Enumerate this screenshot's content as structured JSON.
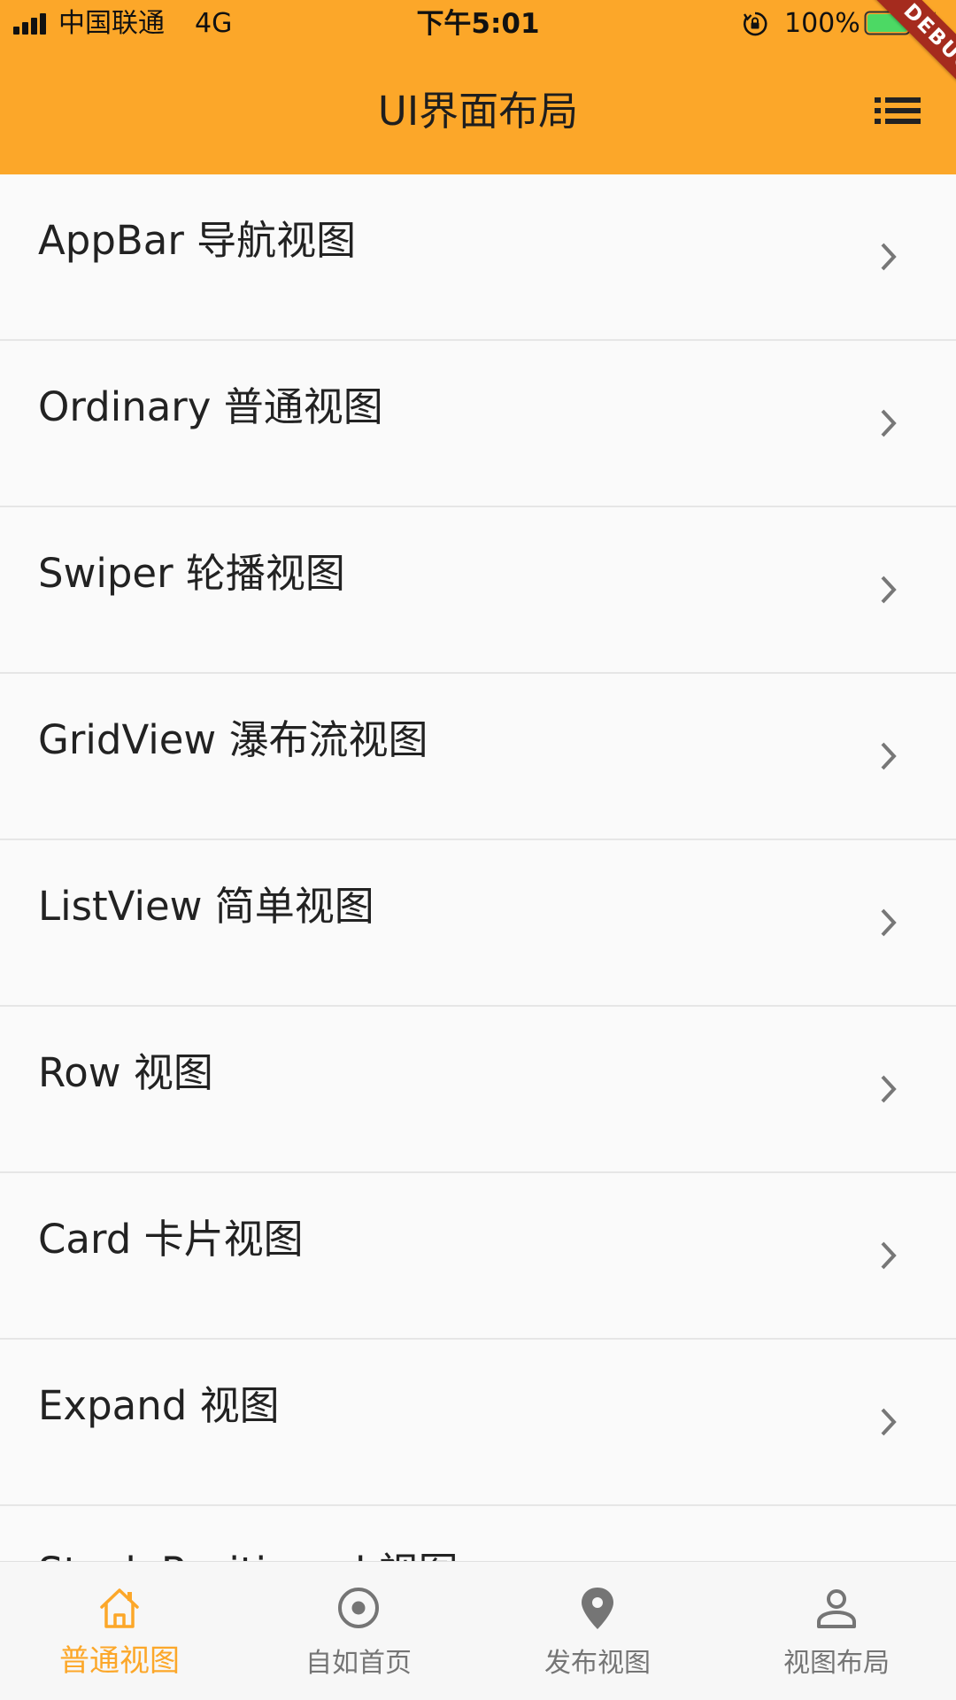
{
  "status_bar": {
    "carrier": "中国联通",
    "network": "4G",
    "time": "下午5:01",
    "battery_percent": "100%",
    "battery_level": 1.0,
    "battery_color": "#4cd964"
  },
  "app_bar": {
    "title": "UI界面布局",
    "menu_icon": "list-menu-icon",
    "background": "#fca729"
  },
  "debug_banner": "DEBUG",
  "list": {
    "items": [
      {
        "label": "AppBar 导航视图"
      },
      {
        "label": "Ordinary 普通视图"
      },
      {
        "label": "Swiper 轮播视图"
      },
      {
        "label": "GridView 瀑布流视图"
      },
      {
        "label": "ListView 简单视图"
      },
      {
        "label": "Row 视图"
      },
      {
        "label": "Card 卡片视图"
      },
      {
        "label": "Expand 视图"
      },
      {
        "label": "Stack Positioned 视图"
      }
    ],
    "trailing_icon": "chevron-right-icon"
  },
  "bottom_nav": {
    "active_color": "#fca729",
    "inactive_color": "#757575",
    "items": [
      {
        "label": "普通视图",
        "icon": "home-icon",
        "active": true
      },
      {
        "label": "自如首页",
        "icon": "radio-target-icon",
        "active": false
      },
      {
        "label": "发布视图",
        "icon": "location-pin-icon",
        "active": false
      },
      {
        "label": "视图布局",
        "icon": "person-icon",
        "active": false
      }
    ]
  }
}
